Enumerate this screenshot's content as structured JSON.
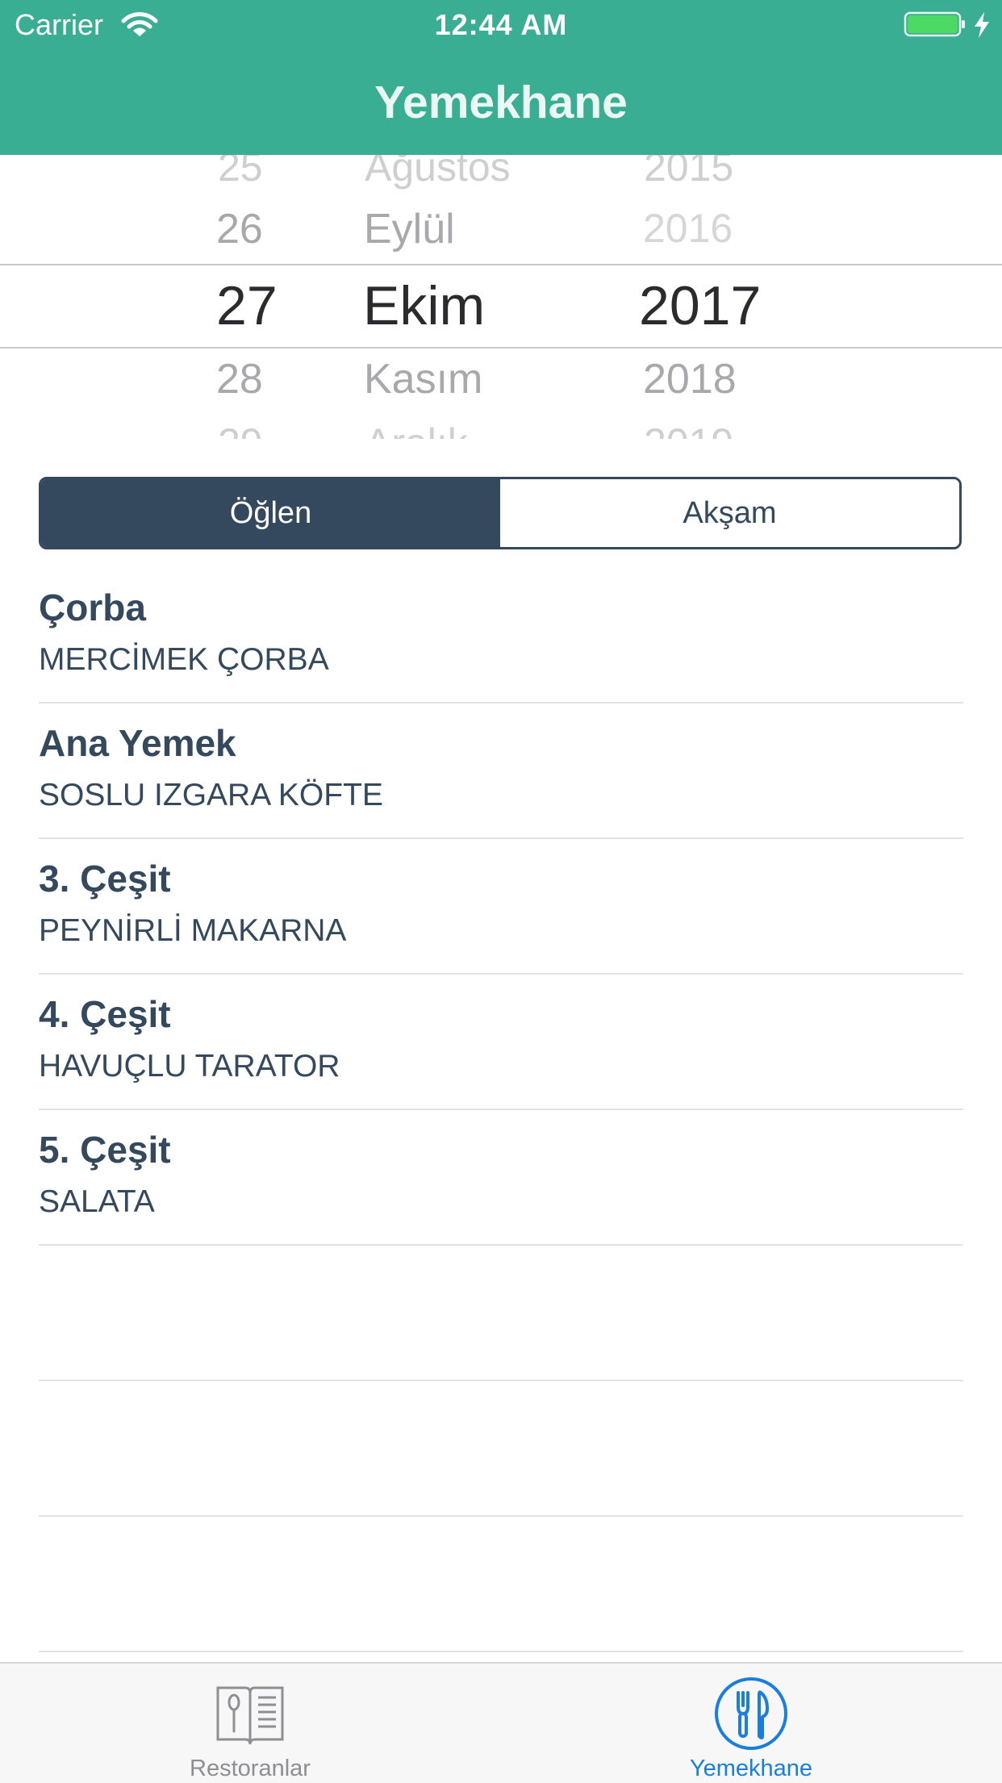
{
  "status_bar": {
    "carrier": "Carrier",
    "time": "12:44 AM",
    "battery_color": "#4cd964"
  },
  "nav": {
    "title": "Yemekhane",
    "color": "#3aae93"
  },
  "date_picker": {
    "day": {
      "above_cut": "25",
      "above": "26",
      "selected": "27",
      "below": "28",
      "below_cut": "29"
    },
    "month": {
      "above_cut": "Ağustos",
      "above": "Eylül",
      "selected": "Ekim",
      "below": "Kasım",
      "below_cut": "Aralık"
    },
    "year": {
      "above_cut": "2015",
      "above": "2016",
      "selected": "2017",
      "below": "2018",
      "below_cut": "2019"
    }
  },
  "segment": {
    "options": [
      "Öğlen",
      "Akşam"
    ],
    "selected": "Öğlen",
    "color": "#34495e"
  },
  "menu": [
    {
      "category": "Çorba",
      "dish": "MERCİMEK ÇORBA"
    },
    {
      "category": "Ana Yemek",
      "dish": "SOSLU IZGARA KÖFTE"
    },
    {
      "category": "3. Çeşit",
      "dish": "PEYNİRLİ MAKARNA"
    },
    {
      "category": "4. Çeşit",
      "dish": "HAVUÇLU TARATOR"
    },
    {
      "category": "5. Çeşit",
      "dish": "SALATA"
    }
  ],
  "tabs": [
    {
      "label": "Restoranlar",
      "icon": "menu-book-icon",
      "active": false
    },
    {
      "label": "Yemekhane",
      "icon": "fork-knife-icon",
      "active": true
    }
  ],
  "colors": {
    "tab_active": "#1a7ee0",
    "tab_inactive": "#8e8e93"
  }
}
